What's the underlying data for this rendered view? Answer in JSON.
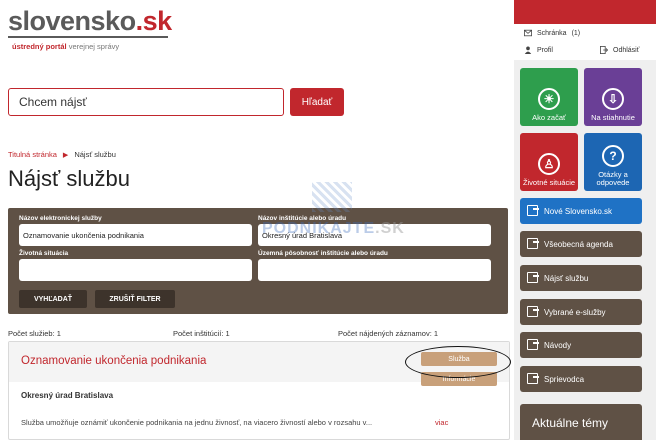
{
  "logo": {
    "name": "slovensko",
    "dot_tld": ".sk",
    "sub_a": "ústredný portál",
    "sub_b": "verejnej správy"
  },
  "search": {
    "placeholder": "Chcem nájsť",
    "button": "Hľadať"
  },
  "breadcrumb": {
    "home": "Titulná stránka",
    "current": "Nájsť službu"
  },
  "page_title": "Nájsť službu",
  "watermark": {
    "a": "PODNIKAJTE",
    "b": ".SK"
  },
  "filter": {
    "service_name_label": "Názov elektronickej služby",
    "service_name_value": "Oznamovanie ukončenia podnikania",
    "institution_label": "Názov inštitúcie alebo úradu",
    "institution_value": "Okresný úrad Bratislava",
    "life_situation_label": "Životná situácia",
    "territorial_label": "Územná pôsobnosť inštitúcie alebo úradu",
    "search_button": "VYHĽADAŤ",
    "clear_button": "ZRUŠIŤ FILTER"
  },
  "counts": {
    "services": "Počet služieb: 1",
    "institutions": "Počet inštitúcií: 1",
    "records": "Počet nájdených záznamov: 1"
  },
  "result": {
    "title": "Oznamovanie ukončenia podnikania",
    "badge_service": "Služba",
    "badge_info": "Informácie",
    "organization": "Okresný úrad Bratislava",
    "description": "Služba umožňuje oznámiť ukončenie podnikania na jednu živnosť, na viacero živností alebo v rozsahu v...",
    "more": "viac"
  },
  "account": {
    "mailbox": "Schránka",
    "mailbox_count": "(1)",
    "profile": "Profil",
    "logout": "Odhlásiť"
  },
  "tiles": [
    {
      "label": "Ako začať",
      "color": "#2e9e4d",
      "icon": "lightbulb-icon"
    },
    {
      "label": "Na stiahnutie",
      "color": "#6a3f96",
      "icon": "download-icon"
    },
    {
      "label": "Životné situácie",
      "color": "#c1272d",
      "icon": "person-icon"
    },
    {
      "label": "Otázky a odpovede",
      "color": "#1d66b3",
      "icon": "question-icon"
    }
  ],
  "nav": [
    {
      "label": "Nové Slovensko.sk",
      "color": "#1f72c5"
    },
    {
      "label": "Všeobecná agenda",
      "color": "#5f5145"
    },
    {
      "label": "Nájsť službu",
      "color": "#5f5145"
    },
    {
      "label": "Vybrané e-služby",
      "color": "#5f5145"
    },
    {
      "label": "Návody",
      "color": "#5f5145"
    },
    {
      "label": "Sprievodca",
      "color": "#5f5145"
    }
  ],
  "topics": "Aktuálne témy",
  "colors": {
    "brand_red": "#c1272d",
    "brown": "#5f5145",
    "badge": "#c8a07a"
  }
}
